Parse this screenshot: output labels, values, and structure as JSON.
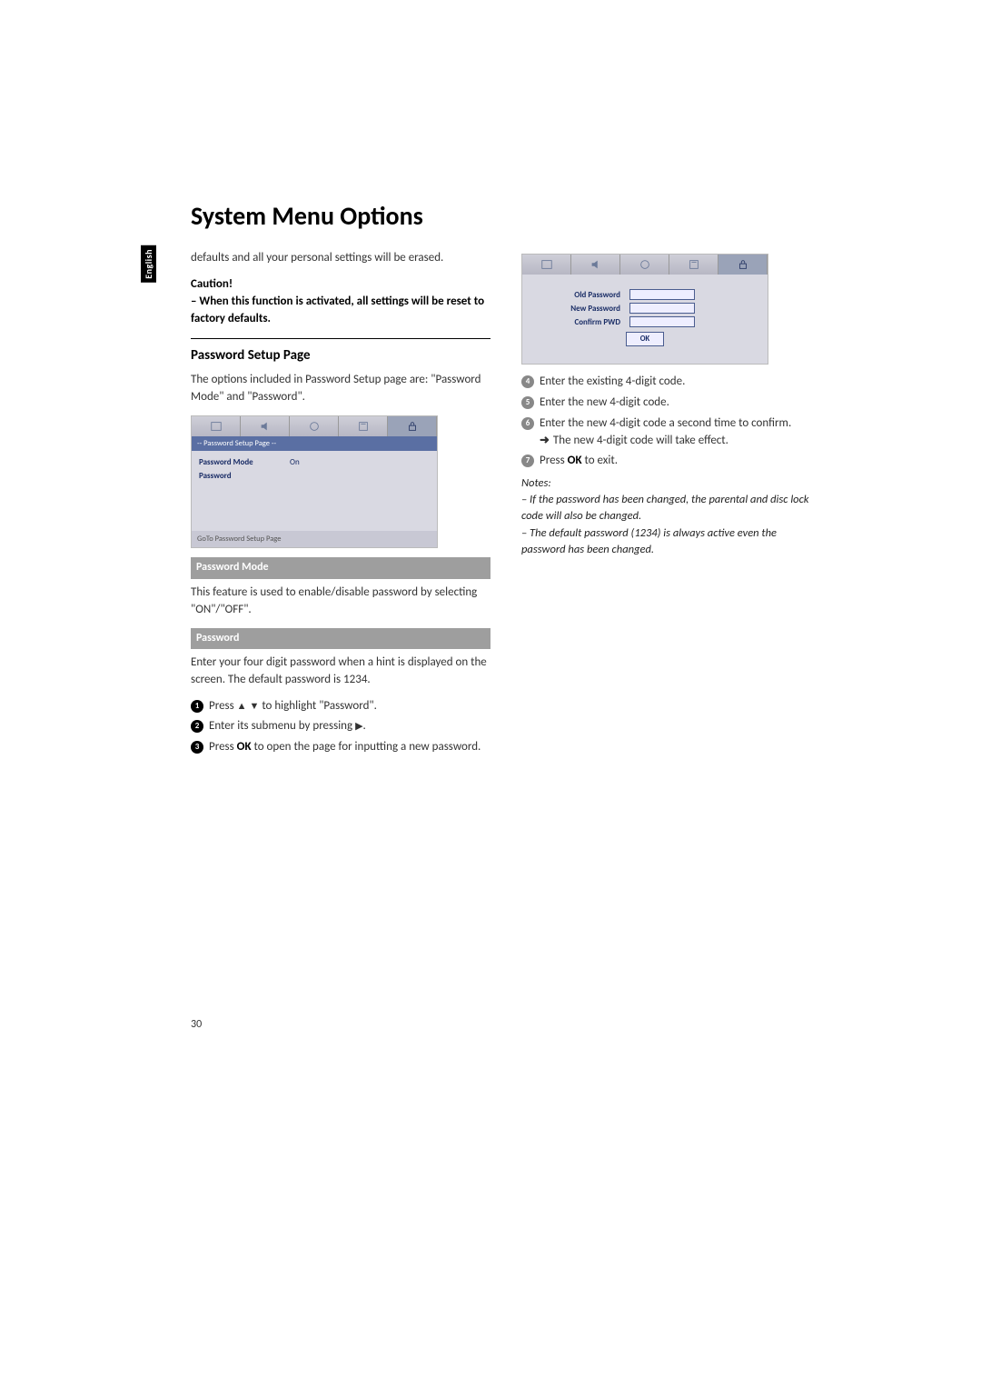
{
  "language_tab": "English",
  "title": "System Menu Options",
  "intro_cont": "defaults and all your personal settings will be erased.",
  "caution_label": "Caution!",
  "caution_text": "– When this function is activated, all settings will be reset to factory defaults.",
  "section_password_setup": "Password Setup Page",
  "password_setup_intro": "The options included in Password Setup page are: \"Password Mode\" and \"Password\".",
  "osd1": {
    "subhead": "-- Password Setup Page --",
    "rows": [
      {
        "lbl": "Password Mode",
        "val": "On"
      },
      {
        "lbl": "Password",
        "val": ""
      }
    ],
    "foot": "GoTo Password Setup Page"
  },
  "bar_password_mode": "Password Mode",
  "password_mode_desc": "This feature is used to enable/disable password by selecting \"ON\"/\"OFF\".",
  "bar_password": "Password",
  "password_desc": "Enter your four digit password when a hint is displayed on the screen. The default password is 1234.",
  "steps_left": {
    "s1_pre": "Press ",
    "s1_mid": " to highlight \"Password\".",
    "s2_pre": "Enter its submenu by pressing ",
    "s2_post": ".",
    "s3_pre": "Press ",
    "s3_bold": "OK",
    "s3_post": " to open the page for inputting a new password."
  },
  "osd2": {
    "rows": [
      {
        "lbl": "Old Password"
      },
      {
        "lbl": "New Password"
      },
      {
        "lbl": "Confirm PWD"
      }
    ],
    "ok": "OK"
  },
  "steps_right": {
    "s4": "Enter the existing 4-digit code.",
    "s5": "Enter the new 4-digit code.",
    "s6_a": "Enter the new 4-digit code a second time to confirm.",
    "s6_result": "The new 4-digit code will take effect.",
    "s7_pre": "Press ",
    "s7_bold": "OK",
    "s7_post": " to exit."
  },
  "notes_label": "Notes:",
  "notes_l1": "– If the password has been changed, the parental and disc lock code will also be changed.",
  "notes_l2": "– The default password (1234) is always active even the password has been changed.",
  "page_number": "30"
}
